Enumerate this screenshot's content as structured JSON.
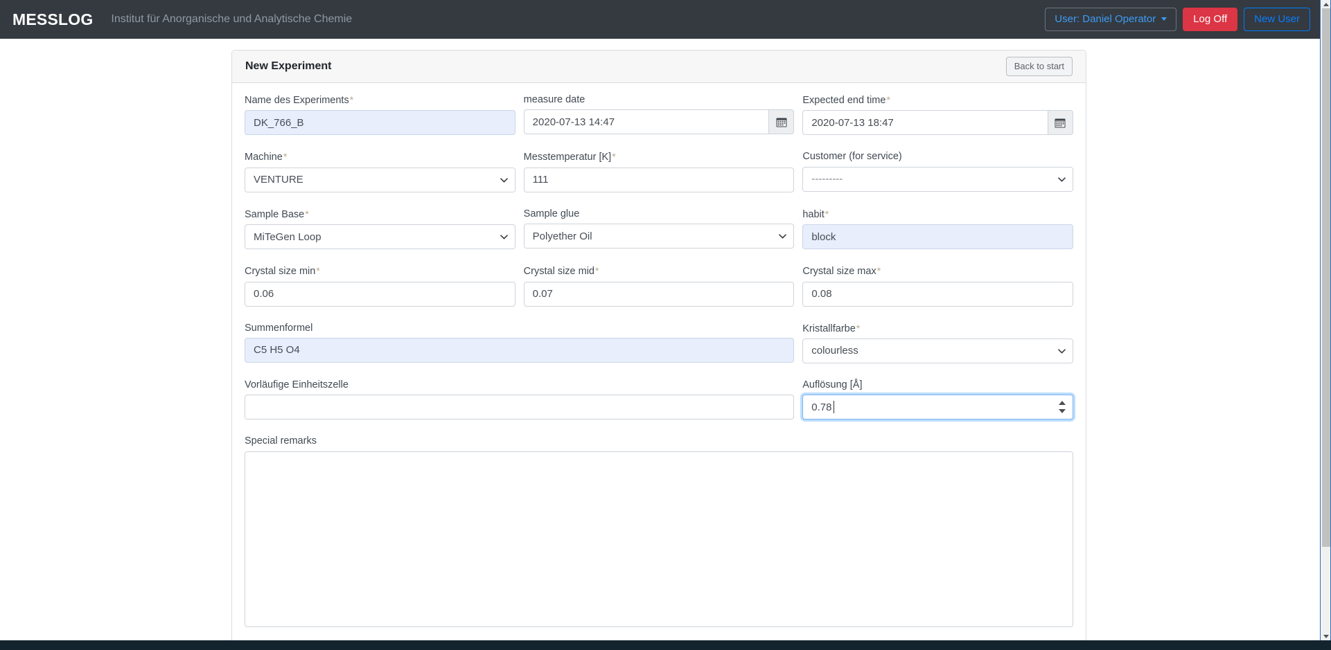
{
  "navbar": {
    "brand": "MESSLOG",
    "institute": "Institut für Anorganische und Analytische Chemie",
    "user_button": "User: Daniel Operator",
    "logoff_button": "Log Off",
    "newuser_button": "New User",
    "background_color": "#343a40",
    "link_color": "#3f9bf5",
    "danger_color": "#dc3545"
  },
  "panel": {
    "title": "New Experiment",
    "back_button": "Back to start"
  },
  "form": {
    "experiment_name": {
      "label": "Name des Experiments",
      "required": true,
      "value": "DK_766_B",
      "autofilled": true
    },
    "measure_date": {
      "label": "measure date",
      "required": false,
      "value": "2020-07-13 14:47",
      "addon_icon": "calendar-icon"
    },
    "expected_end_time": {
      "label": "Expected end time",
      "required": true,
      "value": "2020-07-13 18:47",
      "addon_icon": "calendar-icon"
    },
    "machine": {
      "label": "Machine",
      "required": true,
      "value": "VENTURE"
    },
    "measure_temperature": {
      "label": "Messtemperatur [K]",
      "required": true,
      "value": "111"
    },
    "customer": {
      "label": "Customer (for service)",
      "required": false,
      "value": "---------"
    },
    "sample_base": {
      "label": "Sample Base",
      "required": true,
      "value": "MiTeGen Loop"
    },
    "sample_glue": {
      "label": "Sample glue",
      "required": false,
      "value": "Polyether Oil"
    },
    "habit": {
      "label": "habit",
      "required": true,
      "value": "block",
      "autofilled": true
    },
    "crystal_size_min": {
      "label": "Crystal size min",
      "required": true,
      "value": "0.06"
    },
    "crystal_size_mid": {
      "label": "Crystal size mid",
      "required": true,
      "value": "0.07"
    },
    "crystal_size_max": {
      "label": "Crystal size max",
      "required": true,
      "value": "0.08"
    },
    "summenformel": {
      "label": "Summenformel",
      "required": false,
      "value": "C5 H5 O4",
      "autofilled": true
    },
    "kristallfarbe": {
      "label": "Kristallfarbe",
      "required": true,
      "value": "colourless"
    },
    "unit_cell": {
      "label": "Vorläufige Einheitszelle",
      "required": false,
      "value": ""
    },
    "resolution": {
      "label": "Auflösung [Å]",
      "required": false,
      "value": "0.78",
      "focused": true
    },
    "special_remarks": {
      "label": "Special remarks",
      "required": false,
      "value": ""
    },
    "required_marker": "*"
  }
}
